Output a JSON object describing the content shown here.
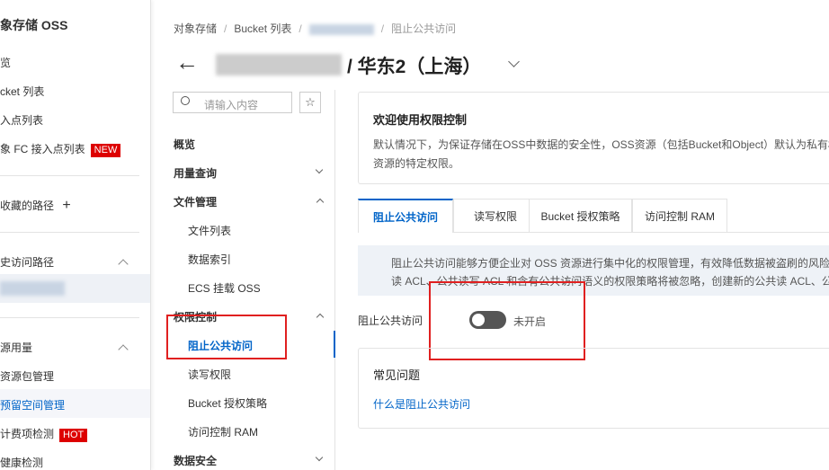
{
  "sidebar": {
    "title": "象存储 OSS",
    "items": [
      {
        "label": "览"
      },
      {
        "label": "cket 列表"
      },
      {
        "label": "入点列表"
      },
      {
        "label": "象 FC 接入点列表",
        "badge": "NEW"
      }
    ],
    "favorites": "收藏的路径",
    "history": "史访问路径",
    "usage": "源用量",
    "usage_items": [
      {
        "label": "资源包管理"
      },
      {
        "label": "预留空间管理"
      },
      {
        "label": "计费项检测",
        "badge": "HOT"
      },
      {
        "label": "健康检测"
      }
    ]
  },
  "breadcrumb": [
    "对象存储",
    "Bucket 列表",
    "阻止公共访问"
  ],
  "header": {
    "title": "/ 华东2（上海）"
  },
  "search": {
    "placeholder": "请输入内容"
  },
  "nav": {
    "overview": "概览",
    "usage": "用量查询",
    "files": "文件管理",
    "file_list": "文件列表",
    "data_index": "数据索引",
    "ecs": "ECS 挂载 OSS",
    "perm": "权限控制",
    "block_public": "阻止公共访问",
    "rw": "读写权限",
    "bucket_policy": "Bucket 授权策略",
    "ram": "访问控制 RAM",
    "security": "数据安全"
  },
  "welcome": {
    "title": "欢迎使用权限控制",
    "text1": "默认情况下，为保证存储在OSS中数据的安全性，OSS资源（包括Bucket和Object）默认为私有权",
    "text2": "资源的特定权限。"
  },
  "tabs": [
    "阻止公共访问",
    "读写权限",
    "Bucket 授权策略",
    "访问控制 RAM"
  ],
  "info": {
    "line1": "阻止公共访问能够方便企业对 OSS 资源进行集中化的权限管理，有效降低数据被盗刷的风险",
    "line2": "读 ACL、公共读写 ACL 和含有公共访问语义的权限策略将被忽略，创建新的公共读 ACL、公共"
  },
  "setting": {
    "label": "阻止公共访问",
    "status": "未开启",
    "enabled": false
  },
  "faq": {
    "title": "常见问题",
    "link": "什么是阻止公共访问"
  },
  "colors": {
    "accent": "#0064c8",
    "badge": "#d00000",
    "highlight": "#e02020"
  }
}
